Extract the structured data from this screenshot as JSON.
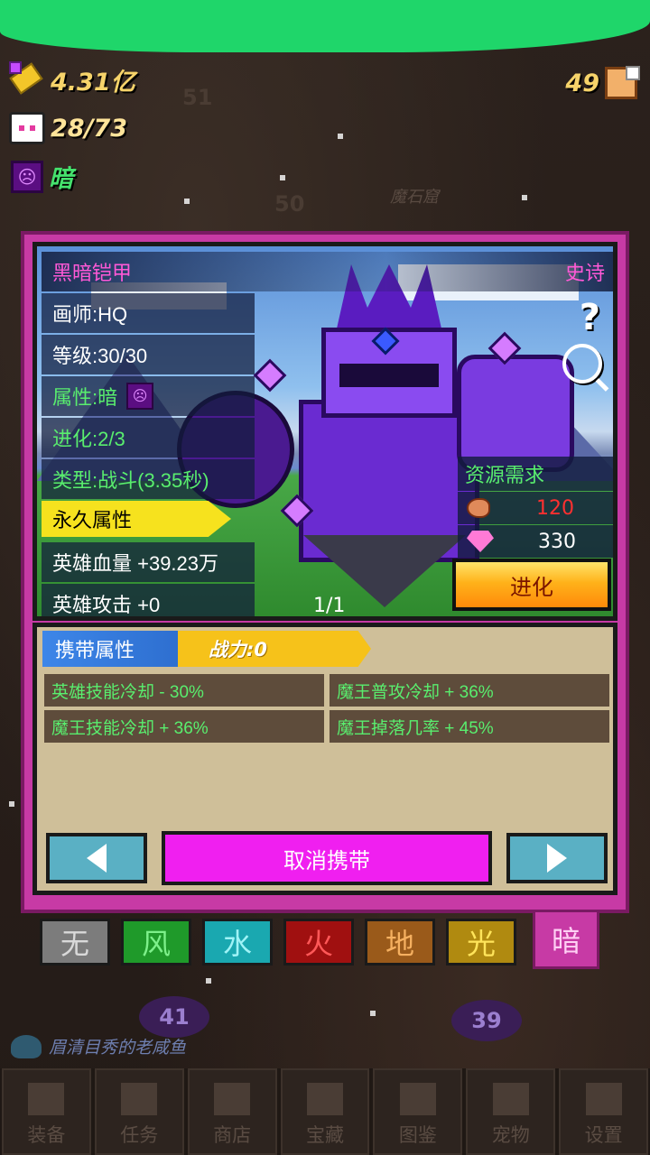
{
  "hud": {
    "gold": "4.31亿",
    "heroes": "28/73",
    "element": "暗",
    "element_glyph": "☹",
    "boxes": "49"
  },
  "map": {
    "numbers": [
      "51",
      "50"
    ],
    "label": "魔石窟",
    "bubbles": [
      "41",
      "39"
    ]
  },
  "hero": {
    "name": "黑暗铠甲",
    "rarity": "史诗",
    "artist": "画师:HQ",
    "level": "等级:30/30",
    "attribute": "属性:暗",
    "attribute_glyph": "☹",
    "evolution": "进化:2/3",
    "type": "类型:战斗(3.35秒)",
    "permanent_label": "永久属性",
    "hp_bonus": "英雄血量 +39.23万",
    "atk_bonus": "英雄攻击 +0",
    "page": "1/1",
    "help_glyph": "?"
  },
  "resources": {
    "title": "资源需求",
    "meat": "120",
    "diamond": "330",
    "evolve_label": "进化"
  },
  "carry": {
    "label": "携带属性",
    "power": "战力:0",
    "attributes": [
      "英雄技能冷却 - 30%",
      "魔王普攻冷却 + 36%",
      "魔王技能冷却 + 36%",
      "魔王掉落几率 + 45%"
    ],
    "uncarry_label": "取消携带"
  },
  "element_tabs": [
    {
      "label": "无",
      "bg": "#7c7c7c",
      "fg": "#d9d9d9"
    },
    {
      "label": "风",
      "bg": "#1f9a2a",
      "fg": "#7df08a"
    },
    {
      "label": "水",
      "bg": "#1aa8b0",
      "fg": "#9ff3f6"
    },
    {
      "label": "火",
      "bg": "#a01010",
      "fg": "#ff5858"
    },
    {
      "label": "地",
      "bg": "#9a5a1a",
      "fg": "#f5b060"
    },
    {
      "label": "光",
      "bg": "#b08a10",
      "fg": "#ffe45a"
    },
    {
      "label": "暗",
      "bg": "#c73aa5",
      "fg": "#ffd0f4"
    }
  ],
  "chat": {
    "text": "眉清目秀的老咸鱼"
  },
  "bottom_nav": [
    "装备",
    "任务",
    "商店",
    "宝藏",
    "图鉴",
    "宠物",
    "设置"
  ]
}
